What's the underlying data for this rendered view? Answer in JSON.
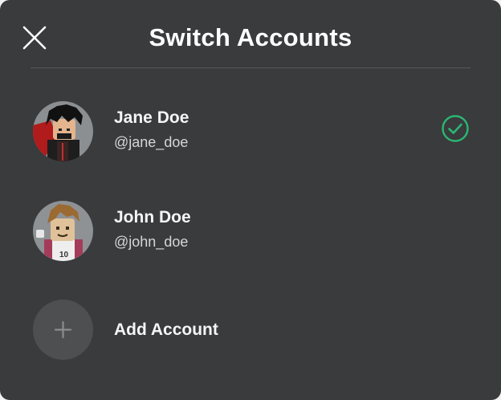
{
  "dialog": {
    "title": "Switch Accounts",
    "close_icon": "close-icon"
  },
  "accounts": [
    {
      "display_name": "Jane Doe",
      "username": "@jane_doe",
      "selected": true,
      "status_icon": "check-circle-icon"
    },
    {
      "display_name": "John Doe",
      "username": "@john_doe",
      "selected": false
    }
  ],
  "add_account": {
    "label": "Add Account",
    "icon": "plus-icon"
  },
  "colors": {
    "background": "#393b3d",
    "divider": "#56585a",
    "accent_green": "#2bb673",
    "add_circle": "#4d4f51"
  }
}
